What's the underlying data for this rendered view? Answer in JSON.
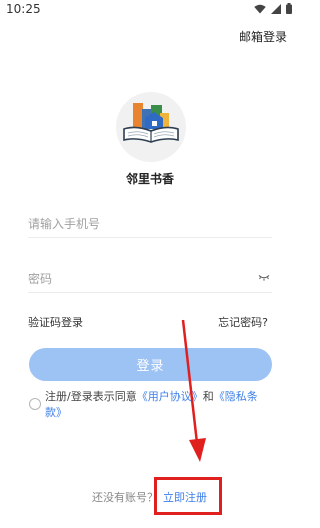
{
  "status_bar": {
    "time": "10:25"
  },
  "header": {
    "email_login_label": "邮箱登录"
  },
  "app": {
    "name": "邻里书香"
  },
  "form": {
    "phone_placeholder": "请输入手机号",
    "password_placeholder": "密码",
    "sms_login_label": "验证码登录",
    "forgot_password_label": "忘记密码?",
    "login_button_label": "登录"
  },
  "agreement": {
    "prefix": "注册/登录表示同意",
    "user_agreement": "《用户协议》",
    "and": "和",
    "privacy_policy": "《隐私条款》"
  },
  "footer": {
    "no_account_text": "还没有账号？",
    "register_label": "立即注册"
  },
  "colors": {
    "primary": "#3d7fe8",
    "login_button_bg": "#9dc2f4",
    "annotation_red": "#e01f1f"
  }
}
